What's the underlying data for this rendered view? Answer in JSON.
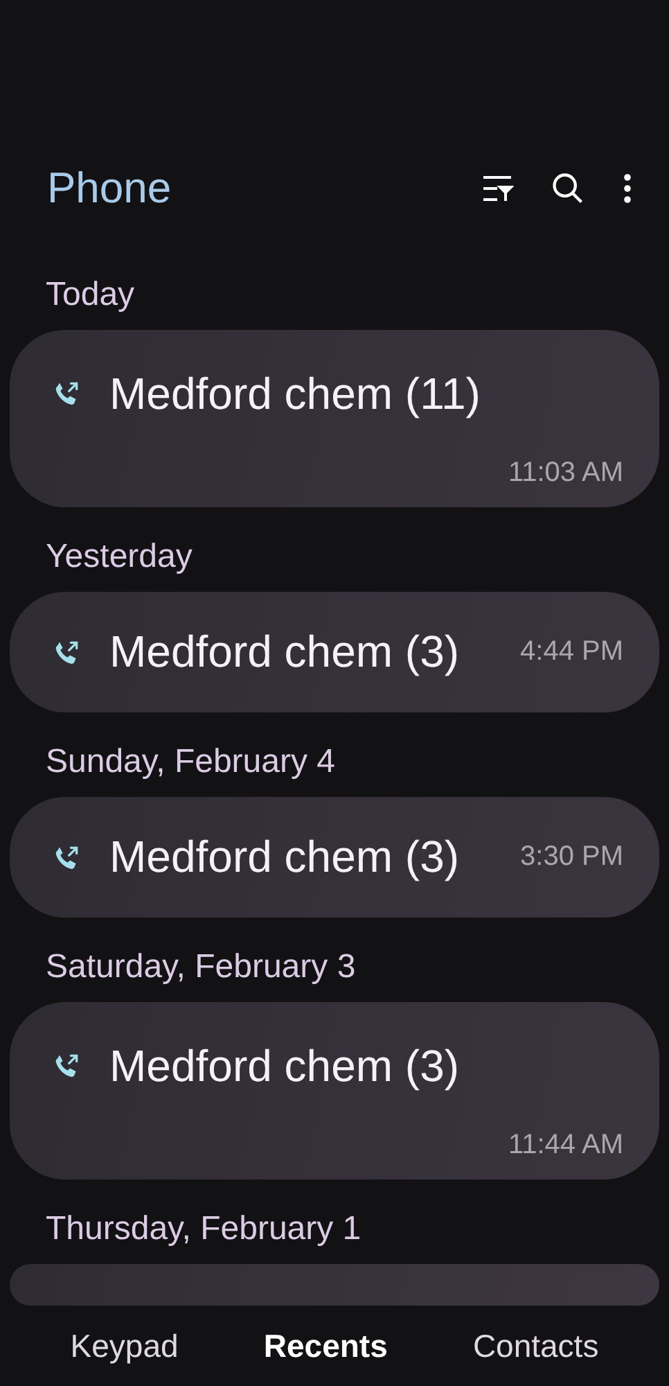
{
  "app_bar": {
    "title": "Phone"
  },
  "sections": [
    {
      "label": "Today",
      "calls": [
        {
          "name": "Medford chem (11)",
          "time": "11:03 AM",
          "kind": "stacked"
        }
      ]
    },
    {
      "label": "Yesterday",
      "calls": [
        {
          "name": "Medford chem (3)",
          "time": "4:44 PM",
          "kind": "inline"
        }
      ]
    },
    {
      "label": "Sunday, February 4",
      "calls": [
        {
          "name": "Medford chem (3)",
          "time": "3:30 PM",
          "kind": "inline"
        }
      ]
    },
    {
      "label": "Saturday, February 3",
      "calls": [
        {
          "name": "Medford chem (3)",
          "time": "11:44 AM",
          "kind": "stacked"
        }
      ]
    },
    {
      "label": "Thursday, February 1"
    }
  ],
  "tabs": [
    {
      "label": "Keypad",
      "selected": false
    },
    {
      "label": "Recents",
      "selected": true
    },
    {
      "label": "Contacts",
      "selected": false
    }
  ]
}
